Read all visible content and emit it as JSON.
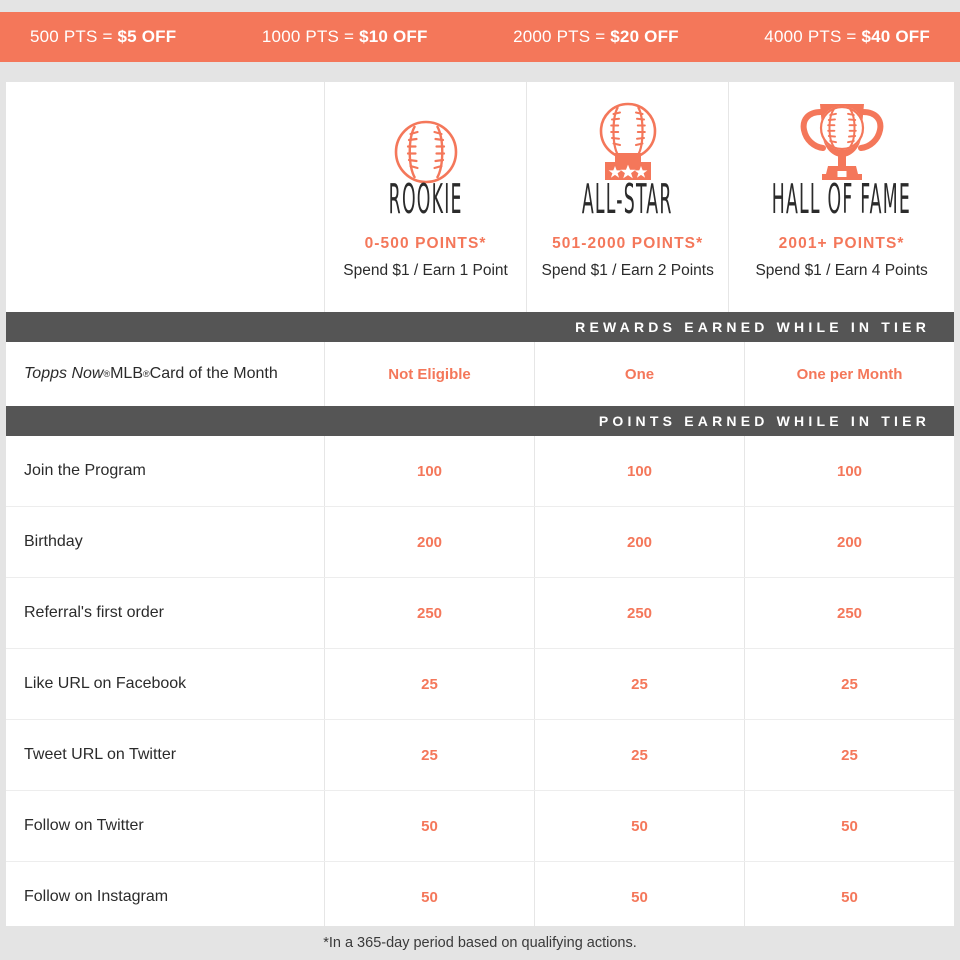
{
  "colors": {
    "accent": "#f4775a",
    "band": "#555555",
    "page_bg": "#e4e4e4",
    "card_bg": "#ffffff",
    "text": "#2b2b2b",
    "divider": "#e6e6e6"
  },
  "promo_banner": {
    "items": [
      {
        "points": "500 PTS = ",
        "discount": "$5 OFF"
      },
      {
        "points": "1000 PTS = ",
        "discount": "$10 OFF"
      },
      {
        "points": "2000 PTS = ",
        "discount": "$20 OFF"
      },
      {
        "points": "4000 PTS = ",
        "discount": "$40 OFF"
      }
    ]
  },
  "tiers": [
    {
      "icon": "baseball-icon",
      "name": "ROOKIE",
      "points_range": "0-500 POINTS*",
      "earn_rate": "Spend $1 / Earn 1 Point"
    },
    {
      "icon": "baseball-on-star-base-icon",
      "name": "ALL-STAR",
      "points_range": "501-2000 POINTS*",
      "earn_rate": "Spend $1 / Earn 2 Points"
    },
    {
      "icon": "trophy-with-baseball-icon",
      "name": "HALL OF FAME",
      "points_range": "2001+ POINTS*",
      "earn_rate": "Spend $1 / Earn 4 Points"
    }
  ],
  "rewards_section": {
    "band_label": "REWARDS EARNED WHILE IN TIER",
    "rows": [
      {
        "label_brand": "Topps Now",
        "label_brand_sup": "®",
        "label_mid": " MLB",
        "label_mid_sup": "®",
        "label_rest": " Card of the Month",
        "values": [
          "Not Eligible",
          "One",
          "One per Month"
        ]
      }
    ]
  },
  "points_section": {
    "band_label": "POINTS EARNED WHILE IN TIER",
    "rows": [
      {
        "label": "Join the Program",
        "values": [
          "100",
          "100",
          "100"
        ]
      },
      {
        "label": "Birthday",
        "values": [
          "200",
          "200",
          "200"
        ]
      },
      {
        "label": "Referral's first order",
        "values": [
          "250",
          "250",
          "250"
        ]
      },
      {
        "label": "Like URL on Facebook",
        "values": [
          "25",
          "25",
          "25"
        ]
      },
      {
        "label": "Tweet URL on Twitter",
        "values": [
          "25",
          "25",
          "25"
        ]
      },
      {
        "label": "Follow on Twitter",
        "values": [
          "50",
          "50",
          "50"
        ]
      },
      {
        "label": "Follow on Instagram",
        "values": [
          "50",
          "50",
          "50"
        ]
      }
    ]
  },
  "footnote": {
    "text": "*In a 365-day period based on qualifying actions."
  }
}
